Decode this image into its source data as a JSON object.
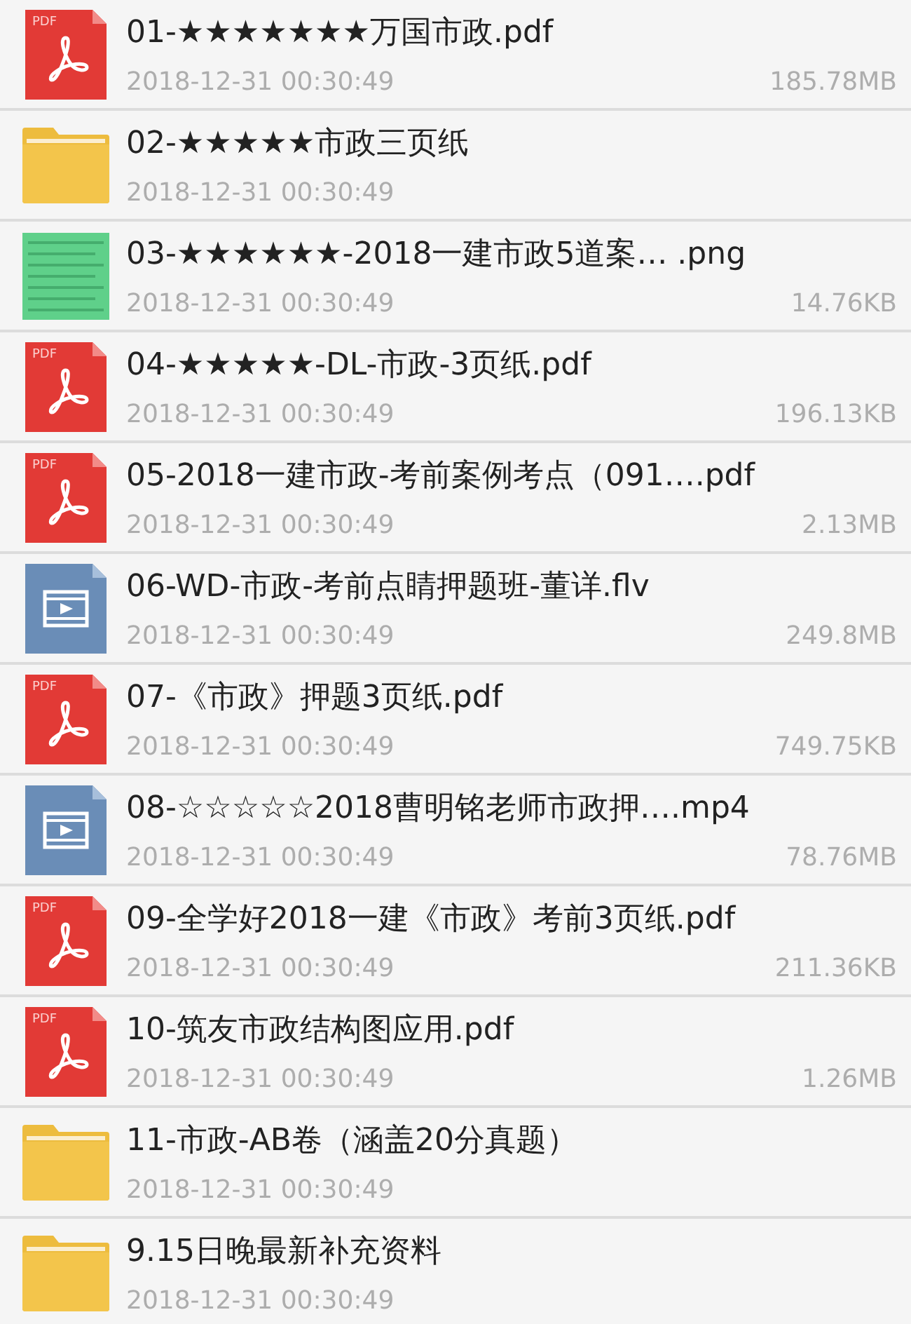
{
  "files": [
    {
      "kind": "pdf",
      "icon_label": "PDF",
      "name": "01-★★★★★★★万国市政.pdf",
      "date": "2018-12-31 00:30:49",
      "size": "185.78MB"
    },
    {
      "kind": "folder",
      "name": "02-★★★★★市政三页纸",
      "date": "2018-12-31 00:30:49"
    },
    {
      "name": "03-★★★★★★-2018一建市政5道案… .png",
      "date": "2018-12-31 00:30:49",
      "size": "14.76KB"
    },
    {
      "kind": "pdf",
      "icon_label": "PDF",
      "name": "04-★★★★★-DL-市政-3页纸.pdf",
      "date": "2018-12-31 00:30:49",
      "size": "196.13KB"
    },
    {
      "kind": "pdf",
      "icon_label": "PDF",
      "name": "05-2018一建市政-考前案例考点（091….pdf",
      "date": "2018-12-31 00:30:49",
      "size": "2.13MB"
    },
    {
      "kind": "video",
      "name": "06-WD-市政-考前点睛押题班-董详.flv",
      "date": "2018-12-31 00:30:49",
      "size": "249.8MB"
    },
    {
      "kind": "pdf",
      "icon_label": "PDF",
      "name": "07-《市政》押题3页纸.pdf",
      "date": "2018-12-31 00:30:49",
      "size": "749.75KB"
    },
    {
      "kind": "video",
      "name": "08-☆☆☆☆☆2018曹明铭老师市政押….mp4",
      "date": "2018-12-31 00:30:49",
      "size": "78.76MB"
    },
    {
      "kind": "pdf",
      "icon_label": "PDF",
      "name": "09-全学好2018一建《市政》考前3页纸.pdf",
      "date": "2018-12-31 00:30:49",
      "size": "211.36KB"
    },
    {
      "kind": "pdf",
      "icon_label": "PDF",
      "name": "10-筑友市政结构图应用.pdf",
      "date": "2018-12-31 00:30:49",
      "size": "1.26MB"
    },
    {
      "kind": "folder",
      "name": "11-市政-AB卷（涵盖20分真题）",
      "date": "2018-12-31 00:30:49"
    },
    {
      "kind": "folder",
      "name": "9.15日晚最新补充资料",
      "date": "2018-12-31 00:30:49"
    }
  ]
}
